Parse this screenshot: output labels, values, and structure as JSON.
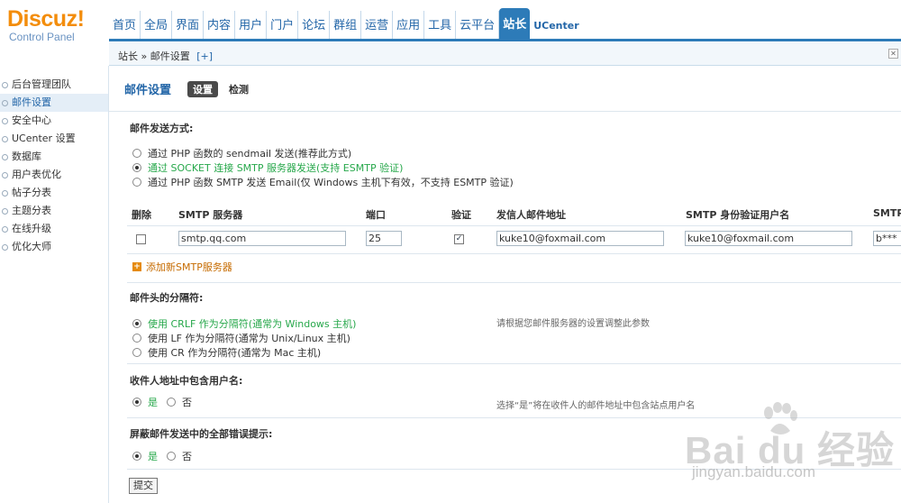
{
  "logo": {
    "brand": "Discuz!",
    "subtitle": "Control Panel"
  },
  "nav": {
    "items": [
      "首页",
      "全局",
      "界面",
      "内容",
      "用户",
      "门户",
      "论坛",
      "群组",
      "运营",
      "应用",
      "工具",
      "云平台",
      "站长",
      "UCenter"
    ],
    "active_index": 12
  },
  "breadcrumb": {
    "path": "站长 » 邮件设置",
    "add": "[+]"
  },
  "sidebar": {
    "items": [
      "后台管理团队",
      "邮件设置",
      "安全中心",
      "UCenter 设置",
      "数据库",
      "用户表优化",
      "帖子分表",
      "主题分表",
      "在线升级",
      "优化大师"
    ],
    "active_index": 1
  },
  "page": {
    "title": "邮件设置",
    "tab_on": "设置",
    "tab_off": "检测"
  },
  "send_method": {
    "title": "邮件发送方式:",
    "options": [
      "通过 PHP 函数的 sendmail 发送(推荐此方式)",
      "通过 SOCKET 连接 SMTP 服务器发送(支持 ESMTP 验证)",
      "通过 PHP 函数 SMTP 发送 Email(仅 Windows 主机下有效，不支持 ESMTP 验证)"
    ],
    "selected": 1
  },
  "smtp_table": {
    "headers": [
      "删除",
      "SMTP 服务器",
      "端口",
      "验证",
      "发信人邮件地址",
      "SMTP 身份验证用户名",
      "SMTP"
    ],
    "row": {
      "delete_checked": false,
      "server": "smtp.qq.com",
      "port": "25",
      "auth_checked": true,
      "from": "kuke10@foxmail.com",
      "username": "kuke10@foxmail.com",
      "password": "b***"
    },
    "add_label": "添加新SMTP服务器"
  },
  "separator": {
    "title": "邮件头的分隔符:",
    "options": [
      "使用 CRLF 作为分隔符(通常为 Windows 主机)",
      "使用 LF 作为分隔符(通常为 Unix/Linux 主机)",
      "使用 CR 作为分隔符(通常为 Mac 主机)"
    ],
    "selected": 0,
    "hint": "请根据您邮件服务器的设置调整此参数"
  },
  "include_user": {
    "title": "收件人地址中包含用户名:",
    "yes": "是",
    "no": "否",
    "selected": "yes",
    "hint": "选择“是”将在收件人的邮件地址中包含站点用户名"
  },
  "hide_errors": {
    "title": "屏蔽邮件发送中的全部错误提示:",
    "yes": "是",
    "no": "否",
    "selected": "yes"
  },
  "submit_label": "提交",
  "watermark": {
    "main": "Bai du 经验",
    "url": "jingyan.baidu.com"
  },
  "colors": {
    "nav_blue": "#2d7bb8",
    "link_blue": "#2366a8",
    "selected_green": "#27a84b",
    "logo_orange": "#f38d0c"
  }
}
